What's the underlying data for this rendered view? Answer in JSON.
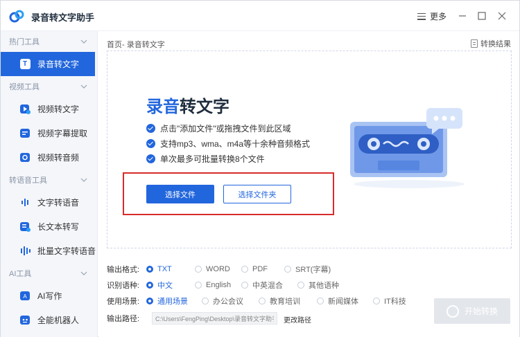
{
  "app": {
    "title": "录音转文字助手",
    "more_label": "更多"
  },
  "sidebar": {
    "sections": [
      {
        "label": "热门工具",
        "items": [
          {
            "label": "录音转文字",
            "active": true
          }
        ]
      },
      {
        "label": "视频工具",
        "items": [
          {
            "label": "视频转文字"
          },
          {
            "label": "视频字幕提取"
          },
          {
            "label": "视频转音频"
          }
        ]
      },
      {
        "label": "转语音工具",
        "items": [
          {
            "label": "文字转语音"
          },
          {
            "label": "长文本转写"
          },
          {
            "label": "批量文字转语音"
          }
        ]
      },
      {
        "label": "AI工具",
        "items": [
          {
            "label": "AI写作"
          },
          {
            "label": "全能机器人"
          }
        ]
      }
    ]
  },
  "main": {
    "breadcrumb": "首页- 录音转文字",
    "convert_results_label": "转换结果",
    "dropzone": {
      "title_blue": "录音",
      "title_dark": "转文字",
      "bullets": [
        "点击\"添加文件\"或拖拽文件到此区域",
        "支持mp3、wma、m4a等十余种音频格式",
        "单次最多可批量转换8个文件"
      ],
      "select_file_label": "选择文件",
      "select_folder_label": "选择文件夹"
    },
    "options": {
      "output_format": {
        "label": "输出格式:",
        "options": [
          "TXT",
          "WORD",
          "PDF",
          "SRT(字幕)"
        ],
        "selected": 0
      },
      "language": {
        "label": "识别语种:",
        "options": [
          "中文",
          "English",
          "中英混合",
          "其他语种"
        ],
        "selected": 0
      },
      "scene": {
        "label": "使用场景:",
        "options": [
          "通用场景",
          "办公会议",
          "教育培训",
          "新闻媒体",
          "IT科技"
        ],
        "selected": 0
      },
      "output_path": {
        "label": "输出路径:",
        "value": "C:\\Users\\FengPing\\Desktop\\录音转文字助手",
        "change_label": "更改路径"
      }
    },
    "start_button_label": "开始转换"
  },
  "colors": {
    "accent": "#2266dd",
    "highlight_border": "#d82b2b",
    "disabled": "#e3e6eb"
  }
}
